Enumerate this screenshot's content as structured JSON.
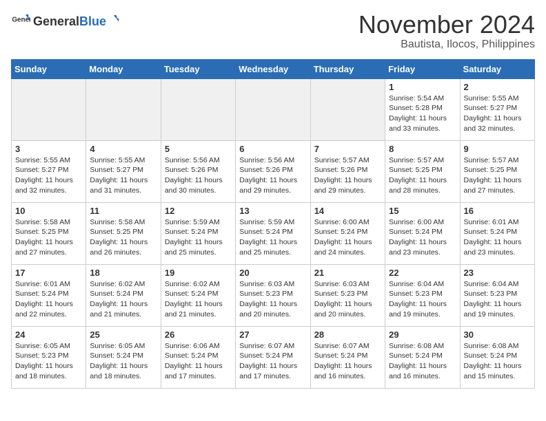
{
  "header": {
    "logo_general": "General",
    "logo_blue": "Blue",
    "month": "November 2024",
    "location": "Bautista, Ilocos, Philippines"
  },
  "weekdays": [
    "Sunday",
    "Monday",
    "Tuesday",
    "Wednesday",
    "Thursday",
    "Friday",
    "Saturday"
  ],
  "weeks": [
    [
      {
        "day": "",
        "info": ""
      },
      {
        "day": "",
        "info": ""
      },
      {
        "day": "",
        "info": ""
      },
      {
        "day": "",
        "info": ""
      },
      {
        "day": "",
        "info": ""
      },
      {
        "day": "1",
        "info": "Sunrise: 5:54 AM\nSunset: 5:28 PM\nDaylight: 11 hours and 33 minutes."
      },
      {
        "day": "2",
        "info": "Sunrise: 5:55 AM\nSunset: 5:27 PM\nDaylight: 11 hours and 32 minutes."
      }
    ],
    [
      {
        "day": "3",
        "info": "Sunrise: 5:55 AM\nSunset: 5:27 PM\nDaylight: 11 hours and 32 minutes."
      },
      {
        "day": "4",
        "info": "Sunrise: 5:55 AM\nSunset: 5:27 PM\nDaylight: 11 hours and 31 minutes."
      },
      {
        "day": "5",
        "info": "Sunrise: 5:56 AM\nSunset: 5:26 PM\nDaylight: 11 hours and 30 minutes."
      },
      {
        "day": "6",
        "info": "Sunrise: 5:56 AM\nSunset: 5:26 PM\nDaylight: 11 hours and 29 minutes."
      },
      {
        "day": "7",
        "info": "Sunrise: 5:57 AM\nSunset: 5:26 PM\nDaylight: 11 hours and 29 minutes."
      },
      {
        "day": "8",
        "info": "Sunrise: 5:57 AM\nSunset: 5:25 PM\nDaylight: 11 hours and 28 minutes."
      },
      {
        "day": "9",
        "info": "Sunrise: 5:57 AM\nSunset: 5:25 PM\nDaylight: 11 hours and 27 minutes."
      }
    ],
    [
      {
        "day": "10",
        "info": "Sunrise: 5:58 AM\nSunset: 5:25 PM\nDaylight: 11 hours and 27 minutes."
      },
      {
        "day": "11",
        "info": "Sunrise: 5:58 AM\nSunset: 5:25 PM\nDaylight: 11 hours and 26 minutes."
      },
      {
        "day": "12",
        "info": "Sunrise: 5:59 AM\nSunset: 5:24 PM\nDaylight: 11 hours and 25 minutes."
      },
      {
        "day": "13",
        "info": "Sunrise: 5:59 AM\nSunset: 5:24 PM\nDaylight: 11 hours and 25 minutes."
      },
      {
        "day": "14",
        "info": "Sunrise: 6:00 AM\nSunset: 5:24 PM\nDaylight: 11 hours and 24 minutes."
      },
      {
        "day": "15",
        "info": "Sunrise: 6:00 AM\nSunset: 5:24 PM\nDaylight: 11 hours and 23 minutes."
      },
      {
        "day": "16",
        "info": "Sunrise: 6:01 AM\nSunset: 5:24 PM\nDaylight: 11 hours and 23 minutes."
      }
    ],
    [
      {
        "day": "17",
        "info": "Sunrise: 6:01 AM\nSunset: 5:24 PM\nDaylight: 11 hours and 22 minutes."
      },
      {
        "day": "18",
        "info": "Sunrise: 6:02 AM\nSunset: 5:24 PM\nDaylight: 11 hours and 21 minutes."
      },
      {
        "day": "19",
        "info": "Sunrise: 6:02 AM\nSunset: 5:24 PM\nDaylight: 11 hours and 21 minutes."
      },
      {
        "day": "20",
        "info": "Sunrise: 6:03 AM\nSunset: 5:23 PM\nDaylight: 11 hours and 20 minutes."
      },
      {
        "day": "21",
        "info": "Sunrise: 6:03 AM\nSunset: 5:23 PM\nDaylight: 11 hours and 20 minutes."
      },
      {
        "day": "22",
        "info": "Sunrise: 6:04 AM\nSunset: 5:23 PM\nDaylight: 11 hours and 19 minutes."
      },
      {
        "day": "23",
        "info": "Sunrise: 6:04 AM\nSunset: 5:23 PM\nDaylight: 11 hours and 19 minutes."
      }
    ],
    [
      {
        "day": "24",
        "info": "Sunrise: 6:05 AM\nSunset: 5:23 PM\nDaylight: 11 hours and 18 minutes."
      },
      {
        "day": "25",
        "info": "Sunrise: 6:05 AM\nSunset: 5:24 PM\nDaylight: 11 hours and 18 minutes."
      },
      {
        "day": "26",
        "info": "Sunrise: 6:06 AM\nSunset: 5:24 PM\nDaylight: 11 hours and 17 minutes."
      },
      {
        "day": "27",
        "info": "Sunrise: 6:07 AM\nSunset: 5:24 PM\nDaylight: 11 hours and 17 minutes."
      },
      {
        "day": "28",
        "info": "Sunrise: 6:07 AM\nSunset: 5:24 PM\nDaylight: 11 hours and 16 minutes."
      },
      {
        "day": "29",
        "info": "Sunrise: 6:08 AM\nSunset: 5:24 PM\nDaylight: 11 hours and 16 minutes."
      },
      {
        "day": "30",
        "info": "Sunrise: 6:08 AM\nSunset: 5:24 PM\nDaylight: 11 hours and 15 minutes."
      }
    ]
  ]
}
